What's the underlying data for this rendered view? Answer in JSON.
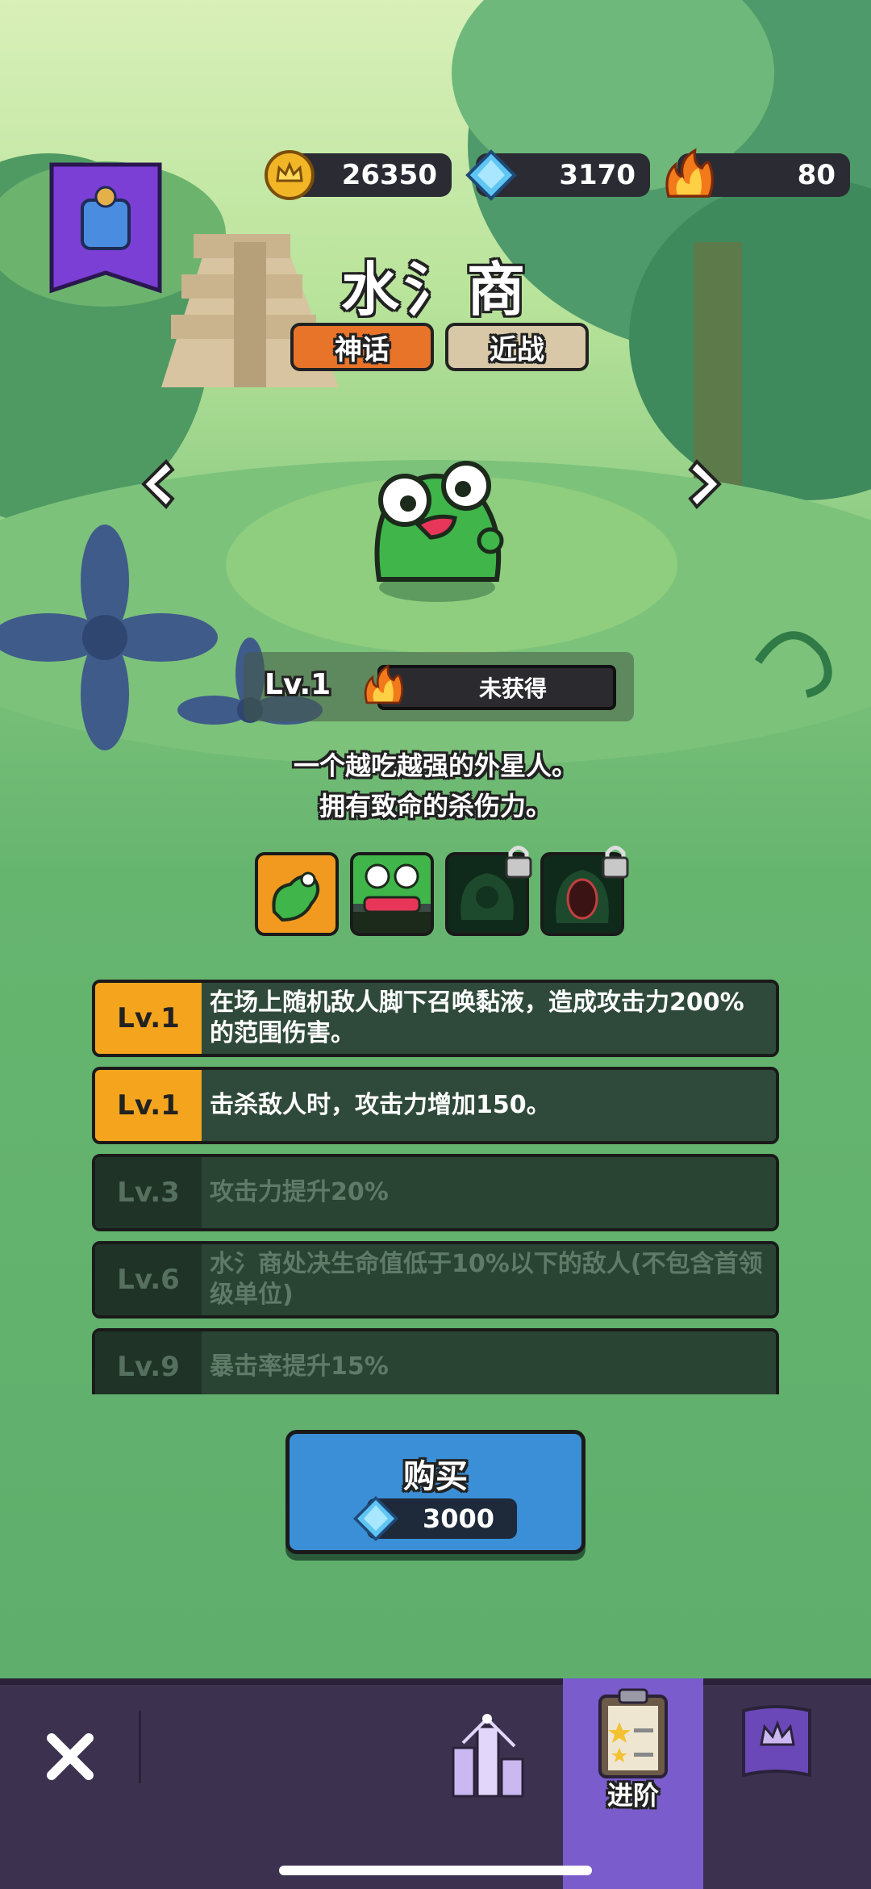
{
  "currency": {
    "gold": "26350",
    "gems": "3170",
    "flames": "80"
  },
  "hero": {
    "name": "水氵商",
    "rarity_tag": "神话",
    "type_tag": "近战",
    "level": "Lv.1",
    "status": "未获得",
    "description_line1": "一个越吃越强的外星人。",
    "description_line2": "拥有致命的杀伤力。"
  },
  "skills": [
    {
      "level": "Lv.1",
      "text": "在场上随机敌人脚下召唤黏液，造成攻击力200%的范围伤害。",
      "unlocked": true
    },
    {
      "level": "Lv.1",
      "text": "击杀敌人时，攻击力增加150。",
      "unlocked": true
    },
    {
      "level": "Lv.3",
      "text": "攻击力提升20%",
      "unlocked": false
    },
    {
      "level": "Lv.6",
      "text": "水氵商处决生命值低于10%以下的敌人(不包含首领级单位)",
      "unlocked": false
    },
    {
      "level": "Lv.9",
      "text": "暴击率提升15%",
      "unlocked": false
    }
  ],
  "buy": {
    "label": "购买",
    "price": "3000"
  },
  "nav": {
    "advance_label": "进阶"
  },
  "colors": {
    "rarity_orange": "#e8742a",
    "type_beige": "#d8c8a8",
    "buy_blue": "#3a8fd6",
    "nav_bg": "#3c3250",
    "nav_active": "#7a5ccc",
    "skill_active": "#f4a51d"
  }
}
